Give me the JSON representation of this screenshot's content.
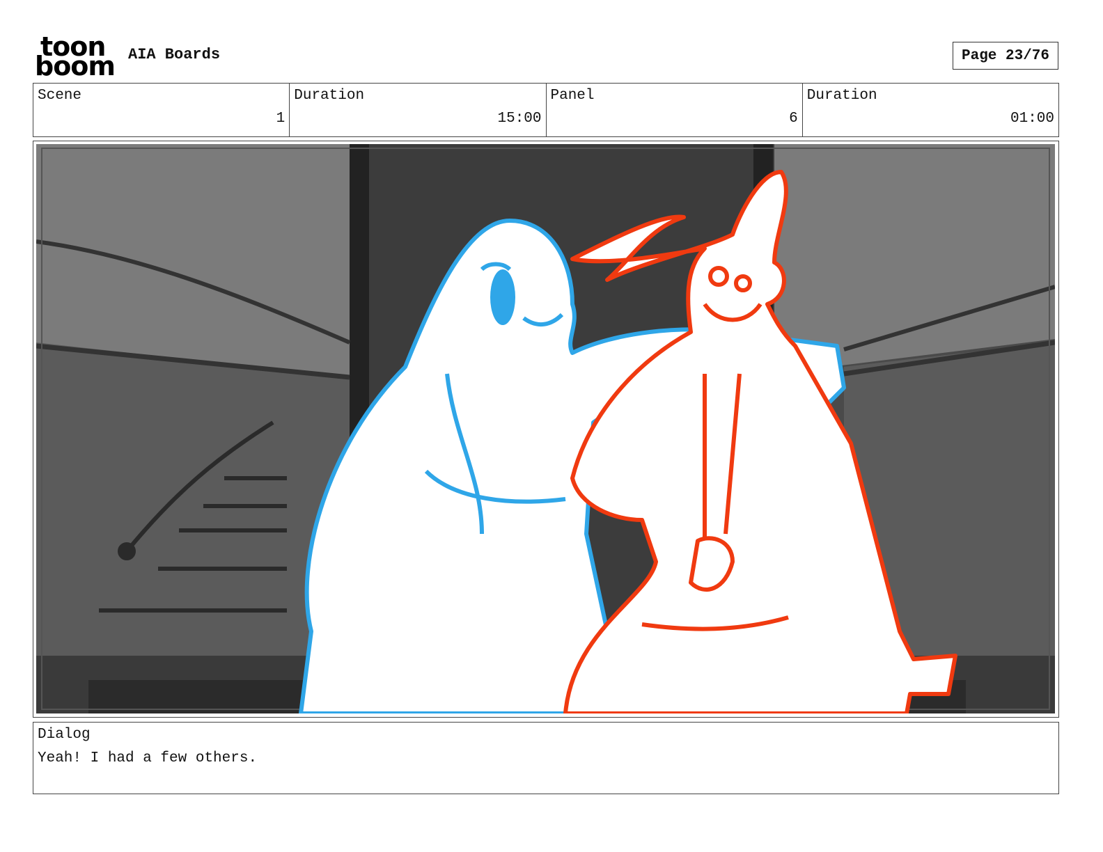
{
  "header": {
    "logo_line1": "toon",
    "logo_line2": "boom",
    "project_title": "AIA Boards",
    "page_label": "Page 23/76"
  },
  "info": {
    "scene_label": "Scene",
    "scene_value": "1",
    "scene_duration_label": "Duration",
    "scene_duration_value": "15:00",
    "panel_label": "Panel",
    "panel_value": "6",
    "panel_duration_label": "Duration",
    "panel_duration_value": "01:00"
  },
  "dialog": {
    "label": "Dialog",
    "text": "Yeah! I had a few others."
  },
  "colors": {
    "character_left": "#2fa6e8",
    "character_right": "#f03a10",
    "background_dark": "#3a3a3a",
    "background_mid": "#7a7a7a"
  }
}
